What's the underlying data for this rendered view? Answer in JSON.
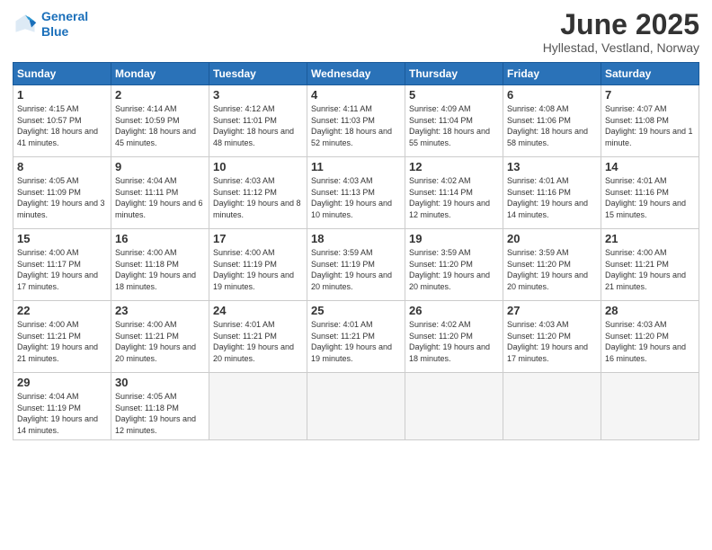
{
  "logo": {
    "line1": "General",
    "line2": "Blue"
  },
  "title": "June 2025",
  "location": "Hyllestad, Vestland, Norway",
  "days_of_week": [
    "Sunday",
    "Monday",
    "Tuesday",
    "Wednesday",
    "Thursday",
    "Friday",
    "Saturday"
  ],
  "weeks": [
    [
      {
        "day": "1",
        "rise": "4:15 AM",
        "set": "10:57 PM",
        "hours": "18 hours and 41 minutes."
      },
      {
        "day": "2",
        "rise": "4:14 AM",
        "set": "10:59 PM",
        "hours": "18 hours and 45 minutes."
      },
      {
        "day": "3",
        "rise": "4:12 AM",
        "set": "11:01 PM",
        "hours": "18 hours and 48 minutes."
      },
      {
        "day": "4",
        "rise": "4:11 AM",
        "set": "11:03 PM",
        "hours": "18 hours and 52 minutes."
      },
      {
        "day": "5",
        "rise": "4:09 AM",
        "set": "11:04 PM",
        "hours": "18 hours and 55 minutes."
      },
      {
        "day": "6",
        "rise": "4:08 AM",
        "set": "11:06 PM",
        "hours": "18 hours and 58 minutes."
      },
      {
        "day": "7",
        "rise": "4:07 AM",
        "set": "11:08 PM",
        "hours": "19 hours and 1 minute."
      }
    ],
    [
      {
        "day": "8",
        "rise": "4:05 AM",
        "set": "11:09 PM",
        "hours": "19 hours and 3 minutes."
      },
      {
        "day": "9",
        "rise": "4:04 AM",
        "set": "11:11 PM",
        "hours": "19 hours and 6 minutes."
      },
      {
        "day": "10",
        "rise": "4:03 AM",
        "set": "11:12 PM",
        "hours": "19 hours and 8 minutes."
      },
      {
        "day": "11",
        "rise": "4:03 AM",
        "set": "11:13 PM",
        "hours": "19 hours and 10 minutes."
      },
      {
        "day": "12",
        "rise": "4:02 AM",
        "set": "11:14 PM",
        "hours": "19 hours and 12 minutes."
      },
      {
        "day": "13",
        "rise": "4:01 AM",
        "set": "11:16 PM",
        "hours": "19 hours and 14 minutes."
      },
      {
        "day": "14",
        "rise": "4:01 AM",
        "set": "11:16 PM",
        "hours": "19 hours and 15 minutes."
      }
    ],
    [
      {
        "day": "15",
        "rise": "4:00 AM",
        "set": "11:17 PM",
        "hours": "19 hours and 17 minutes."
      },
      {
        "day": "16",
        "rise": "4:00 AM",
        "set": "11:18 PM",
        "hours": "19 hours and 18 minutes."
      },
      {
        "day": "17",
        "rise": "4:00 AM",
        "set": "11:19 PM",
        "hours": "19 hours and 19 minutes."
      },
      {
        "day": "18",
        "rise": "3:59 AM",
        "set": "11:19 PM",
        "hours": "19 hours and 20 minutes."
      },
      {
        "day": "19",
        "rise": "3:59 AM",
        "set": "11:20 PM",
        "hours": "19 hours and 20 minutes."
      },
      {
        "day": "20",
        "rise": "3:59 AM",
        "set": "11:20 PM",
        "hours": "19 hours and 20 minutes."
      },
      {
        "day": "21",
        "rise": "4:00 AM",
        "set": "11:21 PM",
        "hours": "19 hours and 21 minutes."
      }
    ],
    [
      {
        "day": "22",
        "rise": "4:00 AM",
        "set": "11:21 PM",
        "hours": "19 hours and 21 minutes."
      },
      {
        "day": "23",
        "rise": "4:00 AM",
        "set": "11:21 PM",
        "hours": "19 hours and 20 minutes."
      },
      {
        "day": "24",
        "rise": "4:01 AM",
        "set": "11:21 PM",
        "hours": "19 hours and 20 minutes."
      },
      {
        "day": "25",
        "rise": "4:01 AM",
        "set": "11:21 PM",
        "hours": "19 hours and 19 minutes."
      },
      {
        "day": "26",
        "rise": "4:02 AM",
        "set": "11:20 PM",
        "hours": "19 hours and 18 minutes."
      },
      {
        "day": "27",
        "rise": "4:03 AM",
        "set": "11:20 PM",
        "hours": "19 hours and 17 minutes."
      },
      {
        "day": "28",
        "rise": "4:03 AM",
        "set": "11:20 PM",
        "hours": "19 hours and 16 minutes."
      }
    ],
    [
      {
        "day": "29",
        "rise": "4:04 AM",
        "set": "11:19 PM",
        "hours": "19 hours and 14 minutes."
      },
      {
        "day": "30",
        "rise": "4:05 AM",
        "set": "11:18 PM",
        "hours": "19 hours and 12 minutes."
      },
      null,
      null,
      null,
      null,
      null
    ]
  ]
}
